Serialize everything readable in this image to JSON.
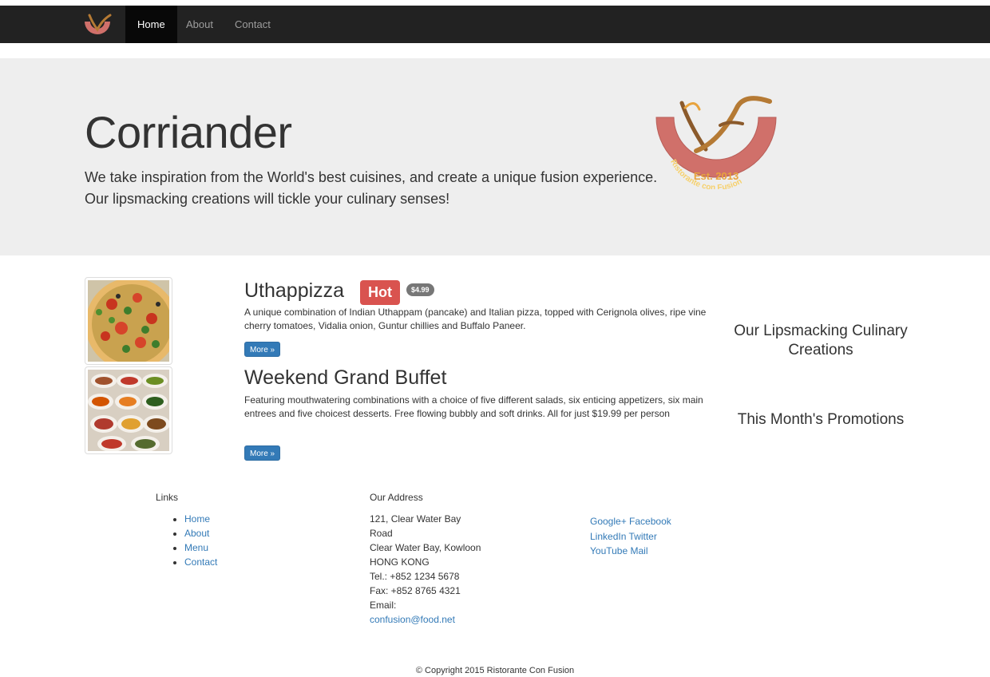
{
  "nav": {
    "items": [
      {
        "label": "Home",
        "active": true
      },
      {
        "label": "About",
        "active": false
      },
      {
        "label": "Contact",
        "active": false
      }
    ]
  },
  "jumbotron": {
    "title": "Corriander",
    "description": "We take inspiration from the World's best cuisines, and create a unique fusion experience. Our lipsmacking creations will tickle your culinary senses!",
    "logo_arc_text": "Ristorante con Fusion",
    "logo_est": "Est. 2013"
  },
  "dishes": [
    {
      "title": "Uthappizza",
      "badge": "Hot",
      "price": "$4.99",
      "description": "A unique combination of Indian Uthappam (pancake) and Italian pizza, topped with Cerignola olives, ripe vine cherry tomatoes, Vidalia onion, Guntur chillies and Buffalo Paneer.",
      "more": "More »",
      "image_icon": "pizza-image"
    },
    {
      "title": "Weekend Grand Buffet",
      "description": "Featuring mouthwatering combinations with a choice of five different salads, six enticing appetizers, six main entrees and five choicest desserts. Free flowing bubbly and soft drinks. All for just $19.99 per person",
      "more": "More »",
      "image_icon": "buffet-image"
    }
  ],
  "sidebar": {
    "heading1": "Our Lipsmacking Culinary Creations",
    "heading2": "This Month's Promotions"
  },
  "footer": {
    "links_title": "Links",
    "links": [
      "Home",
      "About",
      "Menu",
      "Contact"
    ],
    "address_title": "Our Address",
    "address_lines": [
      "121, Clear Water Bay Road",
      "Clear Water Bay, Kowloon",
      "HONG KONG",
      "Tel.: +852 1234 5678",
      "Fax: +852 8765 4321",
      "Email:"
    ],
    "email": "confusion@food.net",
    "social": [
      "Google+",
      "Facebook",
      "LinkedIn",
      "Twitter",
      "YouTube",
      "Mail"
    ],
    "copyright": "© Copyright 2015 Ristorante Con Fusion"
  },
  "colors": {
    "navbar": "#222222",
    "jumbotron": "#eeeeee",
    "link": "#337ab7",
    "hot_badge": "#d9534f",
    "price_badge": "#777777",
    "logo_arc": "#d0706a",
    "logo_brown": "#8b5a2b",
    "logo_gold": "#e8a33d"
  }
}
